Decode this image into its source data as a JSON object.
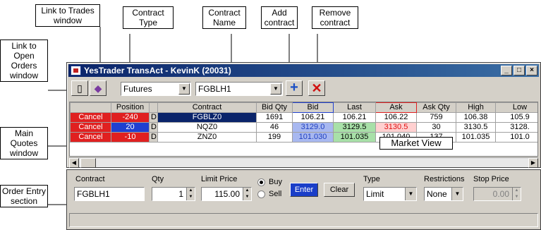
{
  "callouts": {
    "link_trades": "Link to Trades window",
    "contract_type": "Contract Type",
    "contract_name": "Contract Name",
    "add_contract": "Add contract",
    "remove_contract": "Remove contract",
    "link_orders": "Link to Open Orders window",
    "main_quotes": "Main Quotes window",
    "market_view": "Market View",
    "order_entry": "Order Entry section"
  },
  "window": {
    "title": "YesTrader TransAct - KevinK (20031)",
    "minimize": "_",
    "maximize": "□",
    "close": "×"
  },
  "toolbar": {
    "contract_type": "Futures",
    "contract_name": "FGBLH1",
    "add_icon": "plus-icon",
    "remove_icon": "x-icon",
    "colors": {
      "add": "#1a4fc4",
      "remove": "#d01010"
    }
  },
  "quotes": {
    "columns": [
      "",
      "Position",
      "",
      "Contract",
      "Bid Qty",
      "Bid",
      "Last",
      "Ask",
      "Ask Qty",
      "High",
      "Low"
    ],
    "rows": [
      {
        "cancel": "Cancel",
        "position": "-240",
        "flag": "D",
        "contract": "FGBLZ0",
        "bid_qty": "1691",
        "bid": "106.21",
        "last": "106.21",
        "ask": "106.22",
        "ask_qty": "759",
        "high": "106.38",
        "low": "105.9"
      },
      {
        "cancel": "Cancel",
        "position": "20",
        "flag": "D",
        "contract": "NQZ0",
        "bid_qty": "46",
        "bid": "3129.0",
        "last": "3129.5",
        "ask": "3130.5",
        "ask_qty": "30",
        "high": "3130.5",
        "low": "3128."
      },
      {
        "cancel": "Cancel",
        "position": "-10",
        "flag": "D",
        "contract": "ZNZ0",
        "bid_qty": "199",
        "bid": "101.030",
        "last": "101.035",
        "ask": "101.040",
        "ask_qty": "137",
        "high": "101.035",
        "low": "101.0"
      }
    ],
    "colors": {
      "cancel": "#e02020",
      "negative": "#e02020",
      "positive": "#2040d0"
    }
  },
  "order_entry": {
    "contract_label": "Contract",
    "contract_value": "FGBLH1",
    "qty_label": "Qty",
    "qty_value": "1",
    "limit_label": "Limit Price",
    "limit_value": "115.00",
    "buy_label": "Buy",
    "sell_label": "Sell",
    "enter_label": "Enter",
    "clear_label": "Clear",
    "type_label": "Type",
    "type_value": "Limit",
    "restrictions_label": "Restrictions",
    "restrictions_value": "None",
    "stop_label": "Stop Price",
    "stop_value": "0.00"
  }
}
